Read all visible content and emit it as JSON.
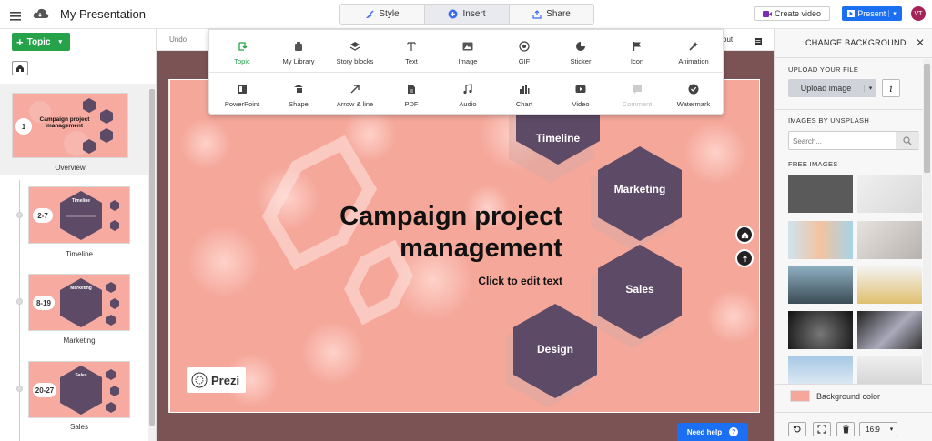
{
  "app": {
    "title": "My Presentation"
  },
  "tabs": [
    {
      "label": "Style",
      "icon": "brush-icon"
    },
    {
      "label": "Insert",
      "icon": "plus-circle-icon"
    },
    {
      "label": "Share",
      "icon": "share-icon"
    }
  ],
  "header": {
    "create_video": "Create video",
    "present": "Present",
    "avatar": "VT"
  },
  "left": {
    "topic_button": "Topic",
    "overview": {
      "badge": "1",
      "title": "Campaign project management",
      "label": "Overview"
    },
    "topics": [
      {
        "badge": "2-7",
        "label": "Timeline",
        "inner": "Timeline"
      },
      {
        "badge": "8-19",
        "label": "Marketing",
        "inner": "Marketing"
      },
      {
        "badge": "20-27",
        "label": "Sales",
        "inner": "Sales"
      }
    ]
  },
  "toolbar": {
    "undo": "Undo",
    "layout": "yout"
  },
  "insert_menu": {
    "row1": [
      {
        "label": "Topic",
        "icon": "topic-icon",
        "active": true
      },
      {
        "label": "My Library",
        "icon": "library-icon"
      },
      {
        "label": "Story blocks",
        "icon": "layers-icon"
      },
      {
        "label": "Text",
        "icon": "text-icon"
      },
      {
        "label": "Image",
        "icon": "image-icon"
      },
      {
        "label": "GIF",
        "icon": "gif-icon"
      },
      {
        "label": "Sticker",
        "icon": "sticker-icon"
      },
      {
        "label": "Icon",
        "icon": "flag-icon"
      },
      {
        "label": "Animation",
        "icon": "animation-icon"
      }
    ],
    "row2": [
      {
        "label": "PowerPoint",
        "icon": "powerpoint-icon"
      },
      {
        "label": "Shape",
        "icon": "shape-icon"
      },
      {
        "label": "Arrow & line",
        "icon": "arrow-icon"
      },
      {
        "label": "PDF",
        "icon": "pdf-icon"
      },
      {
        "label": "Audio",
        "icon": "audio-icon"
      },
      {
        "label": "Chart",
        "icon": "chart-icon"
      },
      {
        "label": "Video",
        "icon": "video-icon"
      },
      {
        "label": "Comment",
        "icon": "comment-icon",
        "disabled": true
      },
      {
        "label": "Watermark",
        "icon": "watermark-icon"
      }
    ]
  },
  "slide": {
    "title_line1": "Campaign project",
    "title_line2": "management",
    "subtitle": "Click to edit text",
    "hexes": [
      "Timeline",
      "Marketing",
      "Sales",
      "Design"
    ],
    "logo": "Prezi"
  },
  "right": {
    "title": "CHANGE BACKGROUND",
    "upload_section": "UPLOAD YOUR FILE",
    "upload_button": "Upload image",
    "unsplash_section": "IMAGES BY UNSPLASH",
    "search_placeholder": "Search...",
    "free_section": "FREE IMAGES",
    "bg_color_label": "Background color",
    "aspect": "16:9",
    "bg_color": "#f5a79a"
  },
  "help": {
    "label": "Need help"
  },
  "colors": {
    "accent_green": "#26a34a",
    "accent_blue": "#1b6ff2",
    "hex_purple": "#5c4a66",
    "slide_pink": "#f5a79a"
  }
}
